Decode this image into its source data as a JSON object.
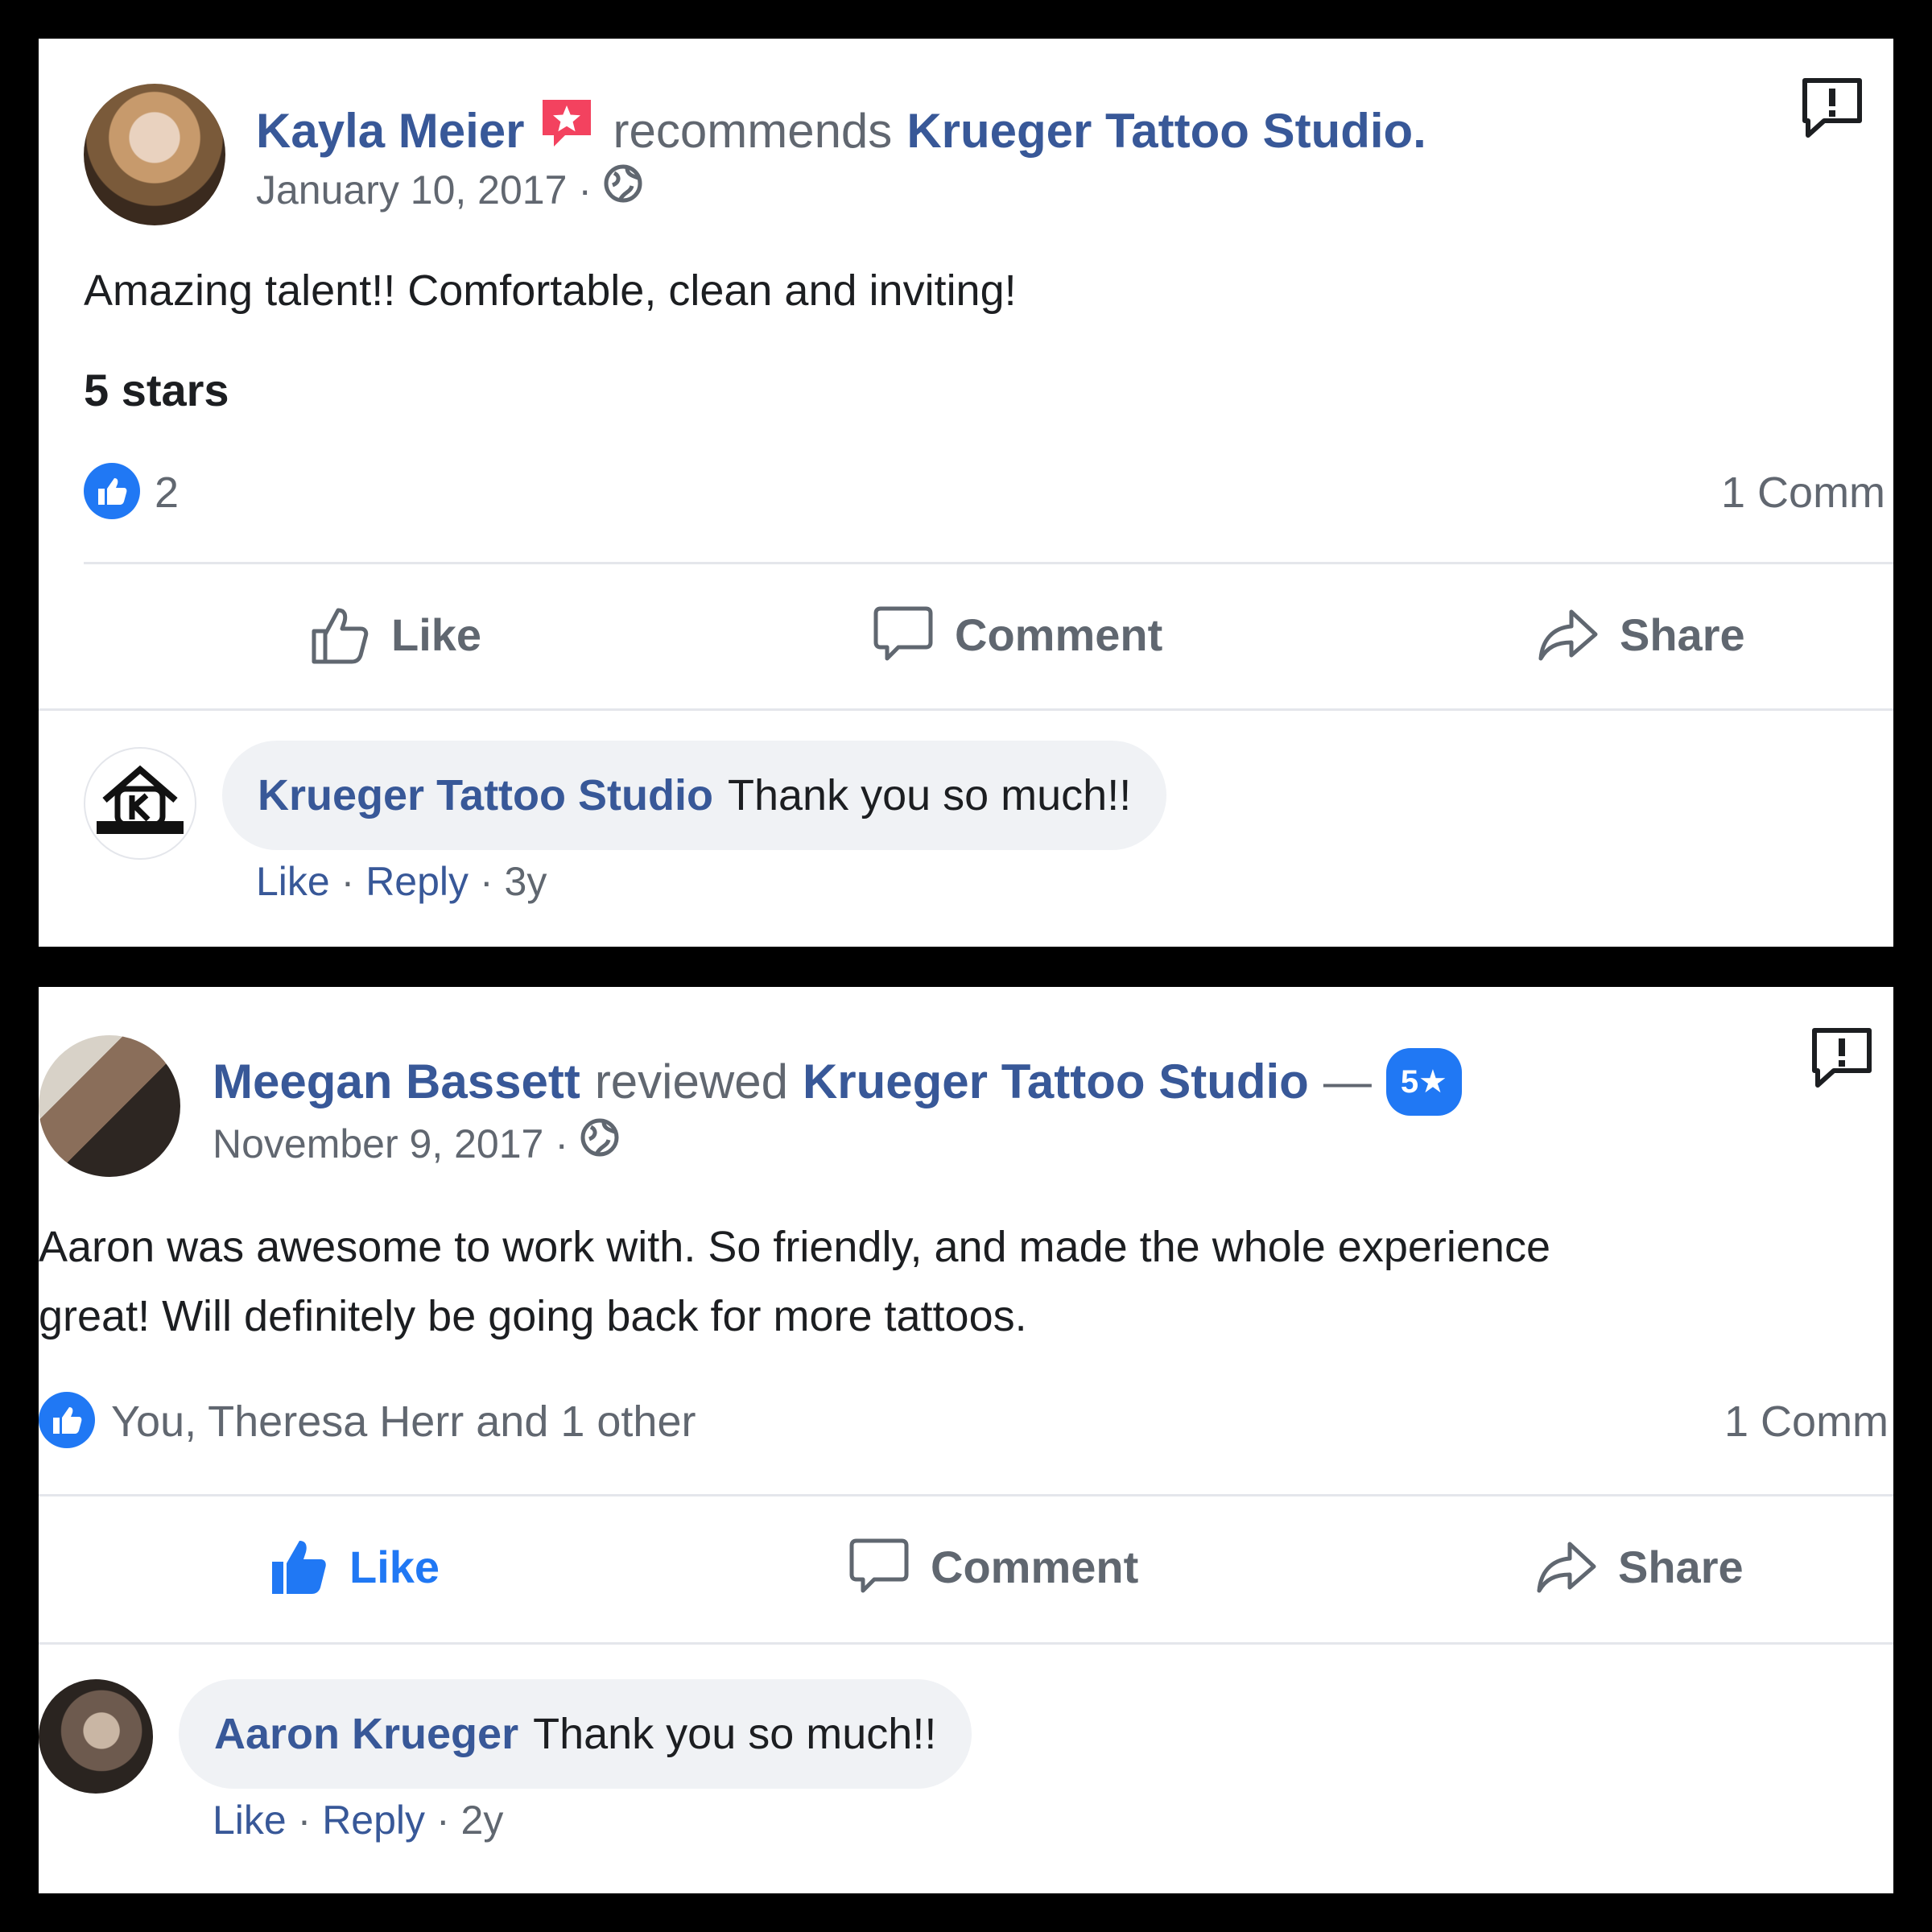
{
  "posts": [
    {
      "author": "Kayla Meier",
      "action_text": "recommends",
      "page_name": "Krueger Tattoo Studio.",
      "date": "January 10, 2017",
      "date_separator": "·",
      "body": [
        "Amazing talent!! Comfortable, clean and inviting!"
      ],
      "rating_text": "5 stars",
      "reaction_count": "2",
      "comments_count": "1 Comm",
      "actions": {
        "like": "Like",
        "comment": "Comment",
        "share": "Share"
      },
      "like_active": false,
      "comment": {
        "author": "Krueger Tattoo Studio",
        "text": "Thank you so much!!",
        "like": "Like",
        "reply": "Reply",
        "age": "3y",
        "separator": "·"
      }
    },
    {
      "author": "Meegan Bassett",
      "action_text": "reviewed",
      "page_name": "Krueger Tattoo Studio",
      "dash": "—",
      "rating_badge": "5★",
      "date": "November 9, 2017",
      "date_separator": "·",
      "body": [
        "Aaron was awesome to work with. So friendly, and made the whole experience",
        "great! Will definitely be going back for more tattoos."
      ],
      "reaction_text": "You, Theresa Herr and 1 other",
      "comments_count": "1 Comm",
      "actions": {
        "like": "Like",
        "comment": "Comment",
        "share": "Share"
      },
      "like_active": true,
      "comment": {
        "author": "Aaron Krueger",
        "text": "Thank you so much!!",
        "like": "Like",
        "reply": "Reply",
        "age": "2y",
        "separator": "·"
      }
    }
  ],
  "icons": {
    "recommend_badge": "recommendation-star-icon",
    "report": "report-exclamation-icon",
    "privacy": "globe-icon",
    "like_reaction": "thumbs-up-icon"
  },
  "colors": {
    "link": "#385898",
    "facebook_blue": "#2078f4",
    "recommend_red": "#f3425f",
    "gray_text": "#606770",
    "bubble_bg": "#f0f2f5"
  }
}
